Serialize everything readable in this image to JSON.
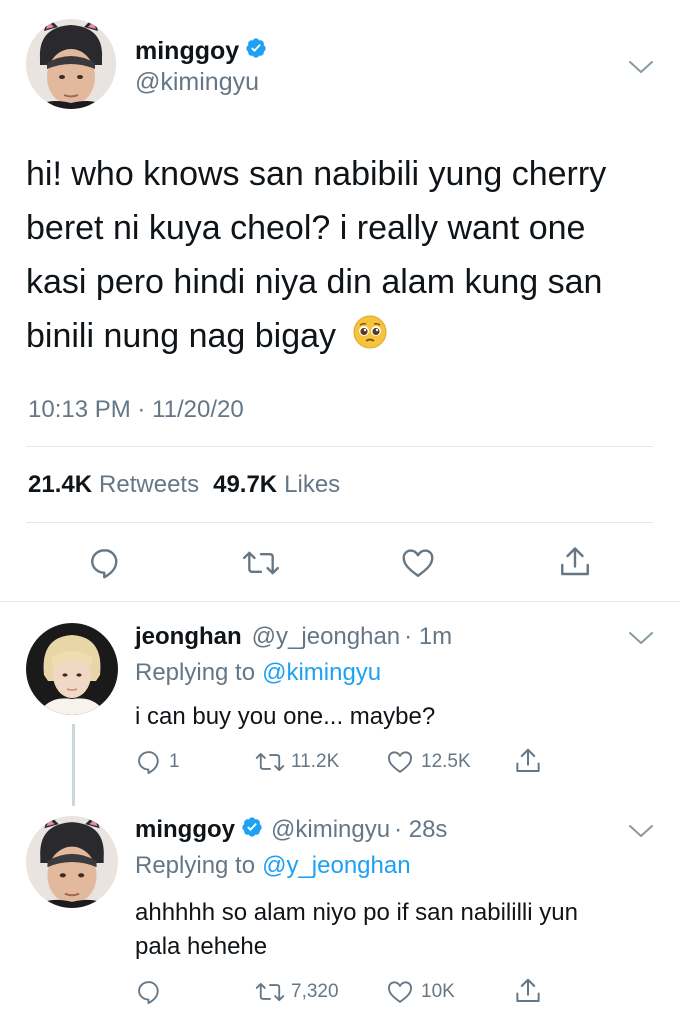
{
  "main_tweet": {
    "display_name": "minggoy",
    "handle": "@kimingyu",
    "text_lines": [
      "hi! who knows san nabibili yung cherry",
      "beret ni kuya cheol? i really want one",
      "kasi pero hindi niya din alam kung san",
      "binili nung nag bigay"
    ],
    "emoji": "🥺",
    "timestamp": "10:13 PM · 11/20/20",
    "retweets_count": "21.4K",
    "retweets_label": "Retweets",
    "likes_count": "49.7K",
    "likes_label": "Likes"
  },
  "reply1": {
    "display_name": "jeonghan",
    "handle": "@y_jeonghan",
    "time": "· 1m",
    "replying_prefix": "Replying to",
    "replying_to": "@kimingyu",
    "text": "i can buy you one... maybe?",
    "reply_count": "1",
    "retweet_count": "11.2K",
    "like_count": "12.5K"
  },
  "reply2": {
    "display_name": "minggoy",
    "handle": "@kimingyu",
    "time": "· 28s",
    "replying_prefix": "Replying to",
    "replying_to": "@y_jeonghan",
    "text_lines": [
      "ahhhhh so alam niyo po if san nabililli yun",
      "pala hehehe"
    ],
    "reply_count": "",
    "retweet_count": "7,320",
    "like_count": "10K"
  },
  "colors": {
    "accent": "#1da1f2",
    "muted": "#657786",
    "divider": "#e1e8ed",
    "thread_line": "#ccd6dd"
  },
  "icons": [
    "reply-icon",
    "retweet-icon",
    "like-icon",
    "share-icon",
    "chevron-down-icon",
    "verified-badge-icon"
  ]
}
